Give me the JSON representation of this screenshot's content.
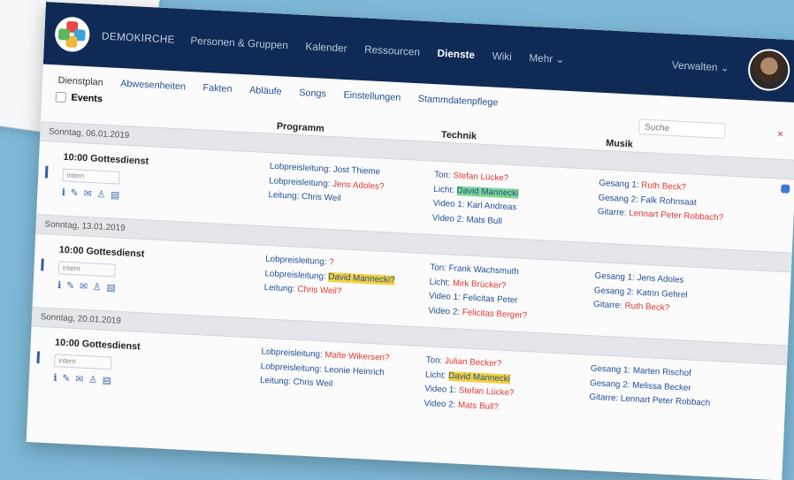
{
  "app": {
    "brand": "DEMOKIRCHE"
  },
  "nav": {
    "items": [
      "Personen & Gruppen",
      "Kalender",
      "Ressourcen",
      "Dienste",
      "Wiki",
      "Mehr"
    ],
    "admin": "Verwalten"
  },
  "subnav": [
    "Dienstplan",
    "Abwesenheiten",
    "Fakten",
    "Abläufe",
    "Songs",
    "Einstellungen",
    "Stammdatenpflege"
  ],
  "toolbar": {
    "events_label": "Events",
    "search_placeholder": "Suche",
    "close": "×"
  },
  "columns": [
    "Programm",
    "Technik",
    "Musik"
  ],
  "services": [
    {
      "date": "Sonntag, 06.01.2019",
      "time": "10:00 Gottesdienst",
      "pill": "intern",
      "programm": [
        {
          "label": "Lobpreisleitung:",
          "value": "Jost Thieme",
          "style": ""
        },
        {
          "label": "Lobpreisleitung:",
          "value": "Jens Adoles?",
          "style": "red"
        },
        {
          "label": "Leitung:",
          "value": "Chris Weil",
          "style": ""
        }
      ],
      "technik": [
        {
          "label": "Ton:",
          "value": "Stefan Lücke?",
          "style": "red"
        },
        {
          "label": "Licht:",
          "value": "David Mannecki",
          "style": "hg"
        },
        {
          "label": "Video 1:",
          "value": "Karl Andreas",
          "style": ""
        },
        {
          "label": "Video 2:",
          "value": "Mats Bull",
          "style": ""
        }
      ],
      "musik": [
        {
          "label": "Gesang 1:",
          "value": "Ruth Beck?",
          "style": "red"
        },
        {
          "label": "Gesang 2:",
          "value": "Falk Rohnsaat",
          "style": ""
        },
        {
          "label": "Gitarre:",
          "value": "Lennart Peter Robbach?",
          "style": "red"
        }
      ]
    },
    {
      "date": "Sonntag, 13.01.2019",
      "time": "10:00 Gottesdienst",
      "pill": "intern",
      "programm": [
        {
          "label": "Lobpreisleitung:",
          "value": "?",
          "style": "red"
        },
        {
          "label": "Lobpreisleitung:",
          "value": "David Mannecki?",
          "style": "hy"
        },
        {
          "label": "Leitung:",
          "value": "Chris Weil?",
          "style": "red"
        }
      ],
      "technik": [
        {
          "label": "Ton:",
          "value": "Frank Wachsmuth",
          "style": ""
        },
        {
          "label": "Licht:",
          "value": "Mirk Brücker?",
          "style": "red"
        },
        {
          "label": "Video 1:",
          "value": "Felicitas Peter",
          "style": ""
        },
        {
          "label": "Video 2:",
          "value": "Felicitas Berger?",
          "style": "red"
        }
      ],
      "musik": [
        {
          "label": "Gesang 1:",
          "value": "Jens Adoles",
          "style": ""
        },
        {
          "label": "Gesang 2:",
          "value": "Katrin Gehrel",
          "style": ""
        },
        {
          "label": "Gitarre:",
          "value": "Ruth Beck?",
          "style": "red"
        }
      ]
    },
    {
      "date": "Sonntag, 20.01.2019",
      "time": "10:00 Gottesdienst",
      "pill": "intern",
      "programm": [
        {
          "label": "Lobpreisleitung:",
          "value": "Malte Wikersen?",
          "style": "red"
        },
        {
          "label": "Lobpreisleitung:",
          "value": "Leonie Heinrich",
          "style": ""
        },
        {
          "label": "Leitung:",
          "value": "Chris Weil",
          "style": ""
        }
      ],
      "technik": [
        {
          "label": "Ton:",
          "value": "Julian Becker?",
          "style": "red"
        },
        {
          "label": "Licht:",
          "value": "David Mannecki",
          "style": "hy"
        },
        {
          "label": "Video 1:",
          "value": "Stefan Lücke?",
          "style": "red"
        },
        {
          "label": "Video 2:",
          "value": "Mats Bull?",
          "style": "red"
        }
      ],
      "musik": [
        {
          "label": "Gesang 1:",
          "value": "Marten Rischof",
          "style": ""
        },
        {
          "label": "Gesang 2:",
          "value": "Melissa Becker",
          "style": ""
        },
        {
          "label": "Gitarre:",
          "value": "Lennart Peter Robbach",
          "style": ""
        }
      ]
    }
  ]
}
